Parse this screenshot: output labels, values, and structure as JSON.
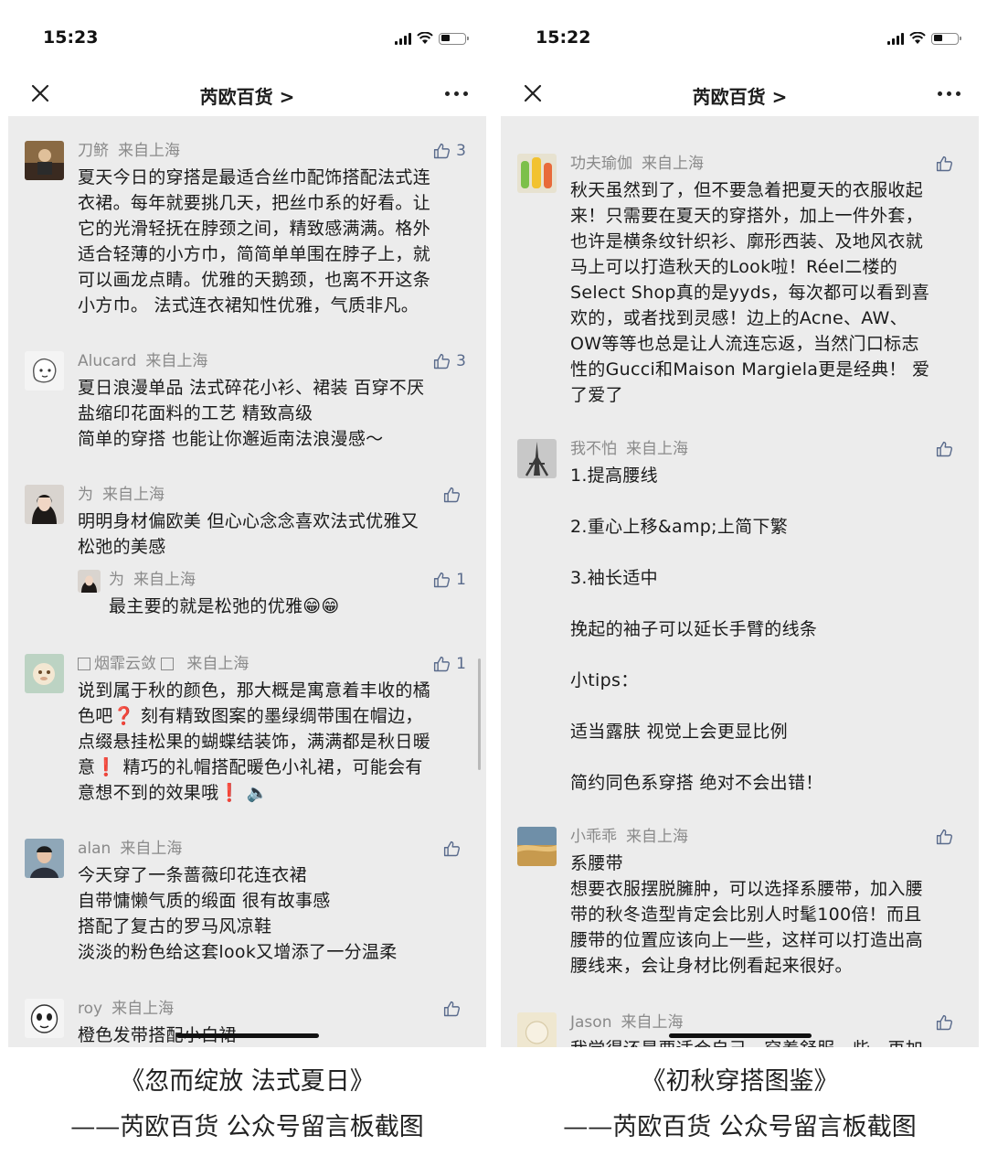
{
  "left_phone": {
    "time": "15:23",
    "nav_title": "芮欧百货 >",
    "comments": [
      {
        "name": "刀鲚",
        "location": "来自上海",
        "likes": "3",
        "text": "夏天今日的穿搭是最适合丝巾配饰搭配法式连\n衣裙。每年就要挑几天，把丝巾系的好看。让\n它的光滑轻抚在脖颈之间，精致感满满。格外\n适合轻薄的小方巾，简简单单围在脖子上，就\n可以画龙点睛。优雅的天鹅颈，也离不开这条\n小方巾。 法式连衣裙知性优雅，气质非凡。"
      },
      {
        "name": "Alucard",
        "location": "来自上海",
        "likes": "3",
        "text": "夏日浪漫单品 法式碎花小衫、裙装 百穿不厌\n盐缩印花面料的工艺 精致高级\n简单的穿搭 也能让你邂逅南法浪漫感～"
      },
      {
        "name": "为",
        "location": "来自上海",
        "likes": "",
        "text": "明明身材偏欧美 但心心念念喜欢法式优雅又\n松弛的美感"
      },
      {
        "name": "为",
        "location": "来自上海",
        "likes": "1",
        "text": "最主要的就是松弛的优雅😁😁"
      },
      {
        "name": "烟霏云敛",
        "location": "来自上海",
        "likes": "1",
        "text": "说到属于秋的颜色，那大概是寓意着丰收的橘\n色吧❓ 刻有精致图案的墨绿绸带围在帽边，\n点缀悬挂松果的蝴蝶结装饰，满满都是秋日暖\n意❗ 精巧的礼帽搭配暖色小礼裙，可能会有\n意想不到的效果哦❗ 🔈"
      },
      {
        "name": "alan",
        "location": "来自上海",
        "likes": "",
        "text": "今天穿了一条蔷薇印花连衣裙\n自带慵懒气质的缎面 很有故事感\n搭配了复古的罗马风凉鞋\n淡淡的粉色给这套look又增添了一分温柔"
      },
      {
        "name": "roy",
        "location": "来自上海",
        "likes": "",
        "text": "橙色发带搭配小白裙"
      }
    ]
  },
  "right_phone": {
    "time": "15:22",
    "nav_title": "芮欧百货 >",
    "comments": [
      {
        "name": "功夫瑜伽",
        "location": "来自上海",
        "likes": "",
        "text": "秋天虽然到了，但不要急着把夏天的衣服收起\n来！只需要在夏天的穿搭外，加上一件外套，\n也许是横条纹针织衫、廓形西装、及地风衣就\n马上可以打造秋天的Look啦！Réel二楼的\nSelect Shop真的是yyds，每次都可以看到喜\n欢的，或者找到灵感！边上的Acne、AW、\nOW等等也总是让人流连忘返，当然门口标志\n性的Gucci和Maison Margiela更是经典！ 爱\n了爱了"
      },
      {
        "name": "我不怕",
        "location": "来自上海",
        "likes": "",
        "text": "1.提高腰线\n\n2.重心上移&amp;上简下繁\n\n3.袖长适中\n\n挽起的袖子可以延长手臂的线条\n\n小tips：\n\n适当露肤 视觉上会更显比例\n\n简约同色系穿搭 绝对不会出错！"
      },
      {
        "name": "小乖乖",
        "location": "来自上海",
        "likes": "",
        "text": "系腰带\n想要衣服摆脱臃肿，可以选择系腰带，加入腰\n带的秋冬造型肯定会比别人时髦100倍！而且\n腰带的位置应该向上一些，这样可以打造出高\n腰线来，会让身材比例看起来很好。"
      },
      {
        "name": "Jason",
        "location": "来自上海",
        "likes": "",
        "text": "我觉得还是要适合自己，穿着舒服一些，再加"
      }
    ]
  },
  "captions": {
    "left_title": "《忽而绽放 法式夏日》",
    "left_sub": "——芮欧百货 公众号留言板截图",
    "right_title": "《初秋穿搭图鉴》",
    "right_sub": "——芮欧百货 公众号留言板截图"
  },
  "icons": {
    "close": "close-icon",
    "more": "more-icon",
    "like": "thumbs-up-icon",
    "signal": "signal-icon",
    "wifi": "wifi-icon",
    "battery": "battery-icon"
  },
  "colors": {
    "content_bg": "#ececec",
    "meta_gray": "#8a8a8a",
    "like_blue": "#5a6b8c"
  }
}
